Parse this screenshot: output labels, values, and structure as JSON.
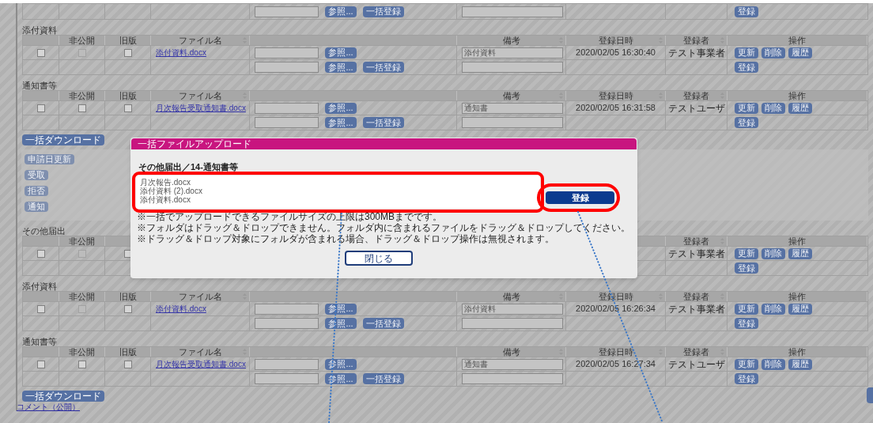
{
  "blocks": [
    {
      "kind": "partial",
      "new_row": {
        "browse": "参照...",
        "bulk": "一括登録",
        "register": "登録"
      }
    },
    {
      "kind": "table",
      "title": "添付資料",
      "columns": {
        "private": "非公開",
        "old": "旧版",
        "file": "ファイル名",
        "note": "備考",
        "date": "登録日時",
        "user": "登録者",
        "ops": "操作"
      },
      "row": {
        "checkboxes": [
          {
            "checked": false,
            "disabled": false
          },
          {
            "checked": false,
            "disabled": true
          },
          {
            "checked": false,
            "disabled": false
          }
        ],
        "file": "添付資料.docx",
        "browse": "参照...",
        "note": "添付資料",
        "date": "2020/02/05 16:30:40",
        "user": "テスト事業者",
        "actions": [
          "更新",
          "削除",
          "履歴"
        ]
      },
      "new_row": {
        "browse": "参照...",
        "bulk": "一括登録",
        "register": "登録"
      }
    },
    {
      "kind": "table",
      "title": "通知書等",
      "columns": {
        "private": "非公開",
        "old": "旧版",
        "file": "ファイル名",
        "note": "備考",
        "date": "登録日時",
        "user": "登録者",
        "ops": "操作"
      },
      "row": {
        "checkboxes": [
          {
            "checked": false,
            "disabled": false
          },
          {
            "checked": false,
            "disabled": false
          },
          {
            "checked": false,
            "disabled": false
          }
        ],
        "file": "月次報告受取通知書.docx",
        "browse": "参照...",
        "note": "通知書",
        "date": "2020/02/05 16:31:58",
        "user": "テストユーザ",
        "actions": [
          "更新",
          "削除",
          "履歴"
        ]
      },
      "new_row": {
        "browse": "参照...",
        "bulk": "一括登録",
        "register": "登録"
      }
    },
    {
      "kind": "download",
      "label": "一括ダウンロード"
    },
    {
      "kind": "actions",
      "buttons": [
        "申請日更新",
        "受取",
        "拒否",
        "通知"
      ]
    },
    {
      "kind": "table",
      "title": "その他届出",
      "columns": {
        "private": "非公開",
        "user": "登録者",
        "ops": "操作"
      },
      "row": {
        "checkboxes": [
          {
            "checked": false,
            "disabled": false
          },
          {
            "checked": false,
            "disabled": true
          },
          {
            "checked": false,
            "disabled": false
          }
        ],
        "user": "テスト事業者",
        "actions": [
          "更新",
          "削除",
          "履歴"
        ]
      },
      "new_row": {
        "register": "登録"
      }
    },
    {
      "kind": "table",
      "title": "添付資料",
      "columns": {
        "private": "非公開",
        "old": "旧版",
        "file": "ファイル名",
        "note": "備考",
        "date": "登録日時",
        "user": "登録者",
        "ops": "操作"
      },
      "row": {
        "checkboxes": [
          {
            "checked": false,
            "disabled": false
          },
          {
            "checked": false,
            "disabled": true
          },
          {
            "checked": false,
            "disabled": false
          }
        ],
        "file": "添付資料.docx",
        "browse": "参照...",
        "note": "添付資料",
        "date": "2020/02/05 16:26:34",
        "user": "テスト事業者",
        "actions": [
          "更新",
          "削除",
          "履歴"
        ]
      },
      "new_row": {
        "browse": "参照...",
        "bulk": "一括登録",
        "register": "登録"
      }
    },
    {
      "kind": "table",
      "title": "通知書等",
      "columns": {
        "private": "非公開",
        "old": "旧版",
        "file": "ファイル名",
        "note": "備考",
        "date": "登録日時",
        "user": "登録者",
        "ops": "操作"
      },
      "row": {
        "checkboxes": [
          {
            "checked": false,
            "disabled": false
          },
          {
            "checked": false,
            "disabled": false
          },
          {
            "checked": false,
            "disabled": false
          }
        ],
        "file": "月次報告受取通知書.docx",
        "browse": "参照...",
        "note": "通知書",
        "date": "2020/02/05 16:27:34",
        "user": "テストユーザ",
        "actions": [
          "更新",
          "削除",
          "履歴"
        ]
      },
      "new_row": {
        "browse": "参照...",
        "bulk": "一括登録",
        "register": "登録"
      }
    },
    {
      "kind": "download",
      "label": "一括ダウンロード"
    },
    {
      "kind": "link",
      "label": "コメント（公開）"
    }
  ],
  "modal": {
    "title": "一括ファイルアップロード",
    "heading": "その他届出／14-通知書等",
    "files": [
      "月次報告.docx",
      "添付資料 (2).docx",
      "添付資料.docx"
    ],
    "register": "登録",
    "notes": [
      "※一括でアップロードできるファイルサイズの上限は300MBまでです。",
      "※フォルダはドラッグ＆ドロップできません。フォルダ内に含まれるファイルをドラッグ＆ドロップしてください。",
      "※ドラッグ＆ドロップ対象にフォルダが含まれる場合、ドラッグ＆ドロップ操作は無視されます。"
    ],
    "close": "閉じる"
  }
}
